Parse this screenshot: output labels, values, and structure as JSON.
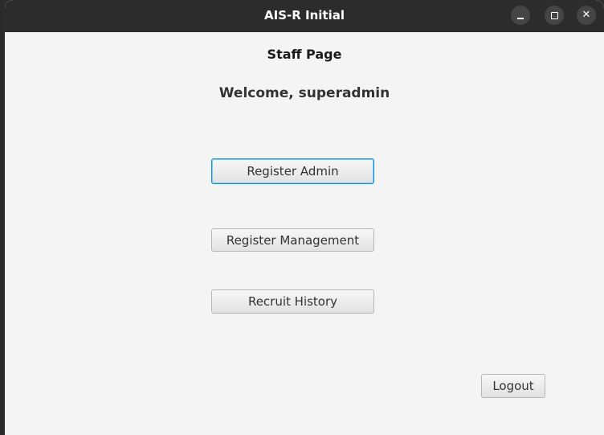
{
  "window": {
    "title": "AIS-R Initial",
    "controls": {
      "minimize": "minimize-icon",
      "maximize": "maximize-icon",
      "close": "close-icon"
    }
  },
  "page": {
    "title": "Staff Page",
    "welcome": "Welcome, superadmin"
  },
  "buttons": {
    "register_admin": "Register Admin",
    "register_management": "Register Management",
    "recruit_history": "Recruit History",
    "logout": "Logout"
  },
  "colors": {
    "titlebar": "#2c2c2c",
    "background": "#f4f4f4",
    "focus_ring": "#0a93d8"
  }
}
